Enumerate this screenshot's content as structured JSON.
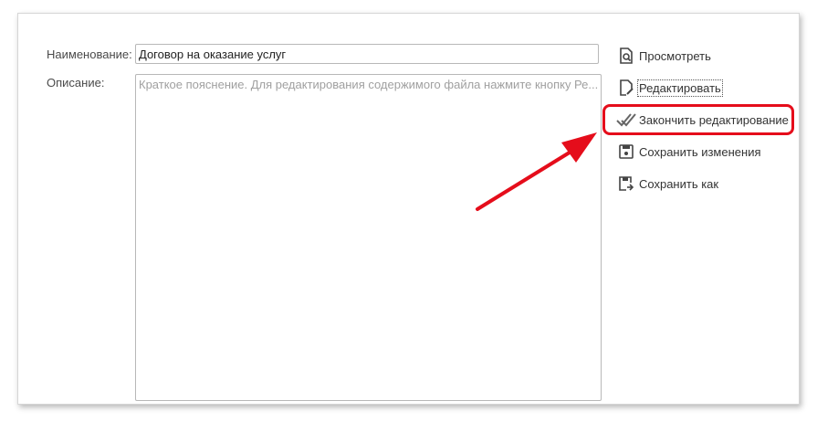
{
  "form": {
    "name_label": "Наименование:",
    "name_value": "Договор на оказание услуг",
    "description_label": "Описание:",
    "description_placeholder": "Краткое пояснение. Для редактирования содержимого файла нажмите кнопку Ре..."
  },
  "commands": [
    {
      "label": "Просмотреть",
      "icon": "magnifier-doc-icon"
    },
    {
      "label": "Редактировать",
      "icon": "edit-doc-icon"
    },
    {
      "label": "Закончить редактирование",
      "icon": "double-check-icon"
    },
    {
      "label": "Сохранить изменения",
      "icon": "save-icon"
    },
    {
      "label": "Сохранить как",
      "icon": "save-as-icon"
    }
  ],
  "colors": {
    "highlight": "#e50d1b",
    "arrow": "#e50d1b"
  }
}
